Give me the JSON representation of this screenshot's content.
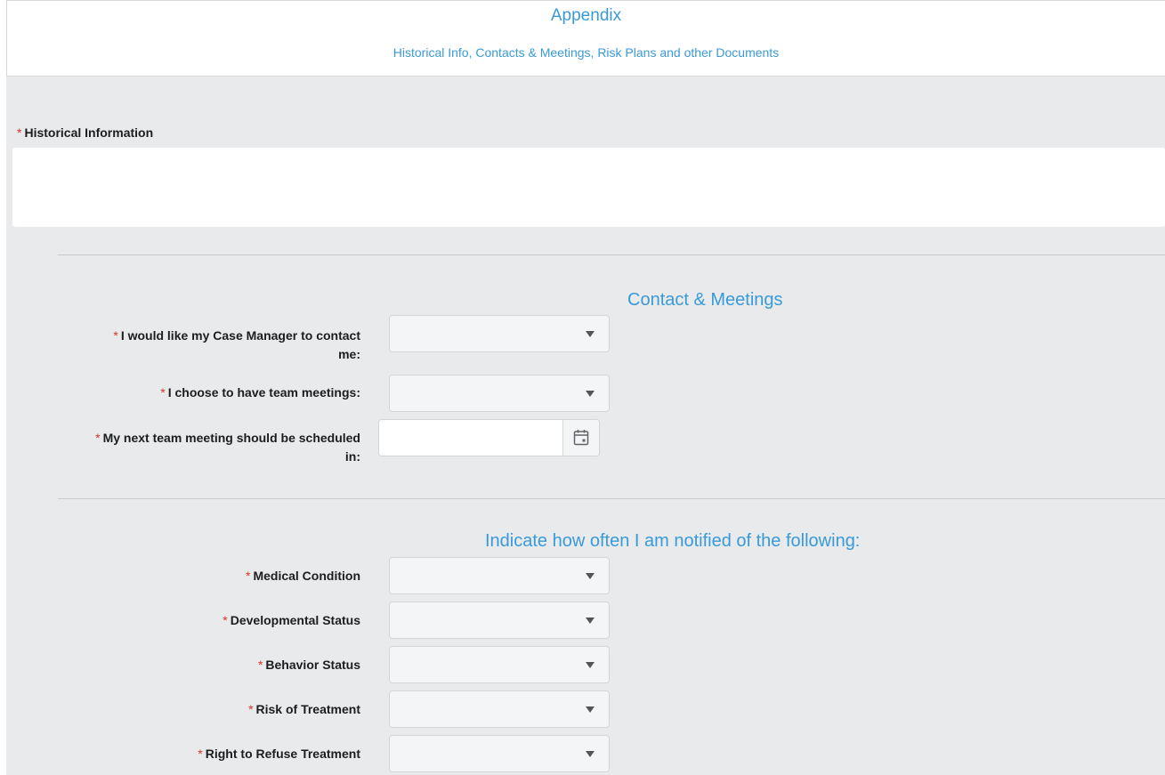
{
  "header": {
    "title": "Appendix",
    "subtitle": "Historical Info, Contacts & Meetings, Risk Plans and other Documents"
  },
  "required_marker": "*",
  "historical": {
    "label": "Historical Information",
    "value": ""
  },
  "contact_section": {
    "title": "Contact & Meetings",
    "fields": [
      {
        "label_line1": "I would like my Case Manager to contact",
        "label_line2": "me:",
        "value": ""
      },
      {
        "label_line1": "I choose to have team meetings:",
        "value": ""
      },
      {
        "label_line1": "My next team meeting should be scheduled",
        "label_line2": "in:",
        "value": ""
      }
    ]
  },
  "notify_section": {
    "title": "Indicate how often I am notified of the following:",
    "fields": [
      {
        "label": "Medical Condition",
        "value": ""
      },
      {
        "label": "Developmental Status",
        "value": ""
      },
      {
        "label": "Behavior Status",
        "value": ""
      },
      {
        "label": "Risk of Treatment",
        "value": ""
      },
      {
        "label": "Right to Refuse Treatment",
        "value": ""
      }
    ]
  },
  "icons": {
    "dropdown": "chevron-down-icon",
    "calendar": "calendar-icon"
  },
  "colors": {
    "accent": "#3a9ad9",
    "required": "#e0302a",
    "background": "#e8eaec"
  }
}
